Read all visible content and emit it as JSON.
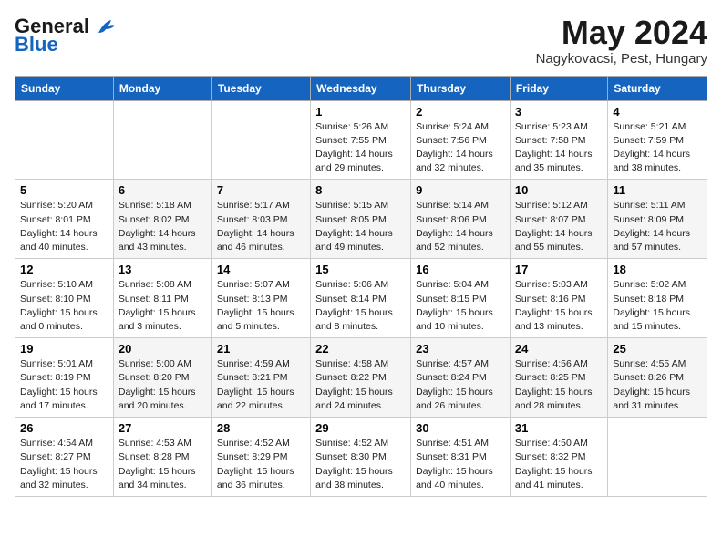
{
  "header": {
    "logo_general": "General",
    "logo_blue": "Blue",
    "month_title": "May 2024",
    "location": "Nagykovacsi, Pest, Hungary"
  },
  "days_of_week": [
    "Sunday",
    "Monday",
    "Tuesday",
    "Wednesday",
    "Thursday",
    "Friday",
    "Saturday"
  ],
  "weeks": [
    [
      {
        "day": "",
        "info": ""
      },
      {
        "day": "",
        "info": ""
      },
      {
        "day": "",
        "info": ""
      },
      {
        "day": "1",
        "info": "Sunrise: 5:26 AM\nSunset: 7:55 PM\nDaylight: 14 hours\nand 29 minutes."
      },
      {
        "day": "2",
        "info": "Sunrise: 5:24 AM\nSunset: 7:56 PM\nDaylight: 14 hours\nand 32 minutes."
      },
      {
        "day": "3",
        "info": "Sunrise: 5:23 AM\nSunset: 7:58 PM\nDaylight: 14 hours\nand 35 minutes."
      },
      {
        "day": "4",
        "info": "Sunrise: 5:21 AM\nSunset: 7:59 PM\nDaylight: 14 hours\nand 38 minutes."
      }
    ],
    [
      {
        "day": "5",
        "info": "Sunrise: 5:20 AM\nSunset: 8:01 PM\nDaylight: 14 hours\nand 40 minutes."
      },
      {
        "day": "6",
        "info": "Sunrise: 5:18 AM\nSunset: 8:02 PM\nDaylight: 14 hours\nand 43 minutes."
      },
      {
        "day": "7",
        "info": "Sunrise: 5:17 AM\nSunset: 8:03 PM\nDaylight: 14 hours\nand 46 minutes."
      },
      {
        "day": "8",
        "info": "Sunrise: 5:15 AM\nSunset: 8:05 PM\nDaylight: 14 hours\nand 49 minutes."
      },
      {
        "day": "9",
        "info": "Sunrise: 5:14 AM\nSunset: 8:06 PM\nDaylight: 14 hours\nand 52 minutes."
      },
      {
        "day": "10",
        "info": "Sunrise: 5:12 AM\nSunset: 8:07 PM\nDaylight: 14 hours\nand 55 minutes."
      },
      {
        "day": "11",
        "info": "Sunrise: 5:11 AM\nSunset: 8:09 PM\nDaylight: 14 hours\nand 57 minutes."
      }
    ],
    [
      {
        "day": "12",
        "info": "Sunrise: 5:10 AM\nSunset: 8:10 PM\nDaylight: 15 hours\nand 0 minutes."
      },
      {
        "day": "13",
        "info": "Sunrise: 5:08 AM\nSunset: 8:11 PM\nDaylight: 15 hours\nand 3 minutes."
      },
      {
        "day": "14",
        "info": "Sunrise: 5:07 AM\nSunset: 8:13 PM\nDaylight: 15 hours\nand 5 minutes."
      },
      {
        "day": "15",
        "info": "Sunrise: 5:06 AM\nSunset: 8:14 PM\nDaylight: 15 hours\nand 8 minutes."
      },
      {
        "day": "16",
        "info": "Sunrise: 5:04 AM\nSunset: 8:15 PM\nDaylight: 15 hours\nand 10 minutes."
      },
      {
        "day": "17",
        "info": "Sunrise: 5:03 AM\nSunset: 8:16 PM\nDaylight: 15 hours\nand 13 minutes."
      },
      {
        "day": "18",
        "info": "Sunrise: 5:02 AM\nSunset: 8:18 PM\nDaylight: 15 hours\nand 15 minutes."
      }
    ],
    [
      {
        "day": "19",
        "info": "Sunrise: 5:01 AM\nSunset: 8:19 PM\nDaylight: 15 hours\nand 17 minutes."
      },
      {
        "day": "20",
        "info": "Sunrise: 5:00 AM\nSunset: 8:20 PM\nDaylight: 15 hours\nand 20 minutes."
      },
      {
        "day": "21",
        "info": "Sunrise: 4:59 AM\nSunset: 8:21 PM\nDaylight: 15 hours\nand 22 minutes."
      },
      {
        "day": "22",
        "info": "Sunrise: 4:58 AM\nSunset: 8:22 PM\nDaylight: 15 hours\nand 24 minutes."
      },
      {
        "day": "23",
        "info": "Sunrise: 4:57 AM\nSunset: 8:24 PM\nDaylight: 15 hours\nand 26 minutes."
      },
      {
        "day": "24",
        "info": "Sunrise: 4:56 AM\nSunset: 8:25 PM\nDaylight: 15 hours\nand 28 minutes."
      },
      {
        "day": "25",
        "info": "Sunrise: 4:55 AM\nSunset: 8:26 PM\nDaylight: 15 hours\nand 31 minutes."
      }
    ],
    [
      {
        "day": "26",
        "info": "Sunrise: 4:54 AM\nSunset: 8:27 PM\nDaylight: 15 hours\nand 32 minutes."
      },
      {
        "day": "27",
        "info": "Sunrise: 4:53 AM\nSunset: 8:28 PM\nDaylight: 15 hours\nand 34 minutes."
      },
      {
        "day": "28",
        "info": "Sunrise: 4:52 AM\nSunset: 8:29 PM\nDaylight: 15 hours\nand 36 minutes."
      },
      {
        "day": "29",
        "info": "Sunrise: 4:52 AM\nSunset: 8:30 PM\nDaylight: 15 hours\nand 38 minutes."
      },
      {
        "day": "30",
        "info": "Sunrise: 4:51 AM\nSunset: 8:31 PM\nDaylight: 15 hours\nand 40 minutes."
      },
      {
        "day": "31",
        "info": "Sunrise: 4:50 AM\nSunset: 8:32 PM\nDaylight: 15 hours\nand 41 minutes."
      },
      {
        "day": "",
        "info": ""
      }
    ]
  ]
}
